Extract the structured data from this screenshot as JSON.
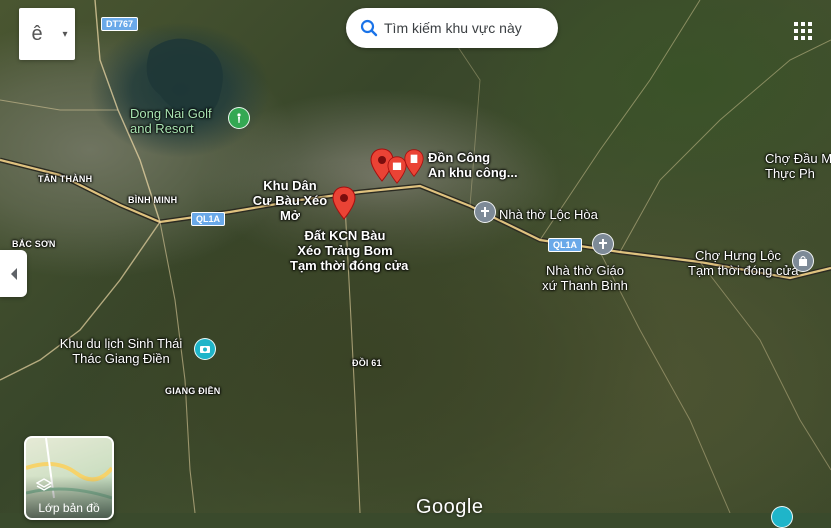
{
  "top_controls": {
    "layer_switch_glyph": "ê",
    "layer_switch_caret": "▾",
    "search_placeholder": "Tìm kiếm khu vực này"
  },
  "routes": {
    "dt767": "DT767",
    "ql1a_west": "QL1A",
    "ql1a_east": "QL1A"
  },
  "places": {
    "golf": {
      "line1": "Dong Nai Golf",
      "line2": "and Resort"
    },
    "khu_dan_cu": {
      "line1": "Khu Dân",
      "line2": "Cư Bàu Xéo",
      "line3": "Mở"
    },
    "kcn": {
      "line1": "Đất KCN Bàu",
      "line2": "Xéo Trảng Bom",
      "status": "Tạm thời đóng cửa"
    },
    "don_cong_an": {
      "line1": "Đồn Công",
      "line2": "An khu công..."
    },
    "nha_tho_loc_hoa": "Nhà thờ Lộc Hòa",
    "nha_tho_giao_xu": {
      "line1": "Nhà thờ Giáo",
      "line2": "xứ Thanh Bình"
    },
    "cho_hung_loc": {
      "name": "Chợ Hưng Lộc",
      "status": "Tạm thời đóng cửa"
    },
    "cho_dau_moi": {
      "line1": "Chợ Đầu M",
      "line2": "Thực Ph"
    },
    "khu_du_lich": {
      "line1": "Khu du lịch Sinh Thái",
      "line2": "Thác Giang Điền"
    }
  },
  "localities": {
    "tan_thanh": "TÂN THÀNH",
    "binh_minh": "BÌNH MINH",
    "bac_son": "BẮC SƠN",
    "giang_dien": "GIANG ĐIỀN",
    "doi_61": "ĐỒI 61"
  },
  "layers": {
    "label": "Lớp bản đồ"
  },
  "google_logo": "Google",
  "colors": {
    "pin_red": "#ea4335",
    "poi_green": "#34a853",
    "poi_teal": "#1fb5c9",
    "poi_gray": "#7d8a97",
    "search_blue": "#1a73e8",
    "road_yellow": "#f3d38a"
  }
}
